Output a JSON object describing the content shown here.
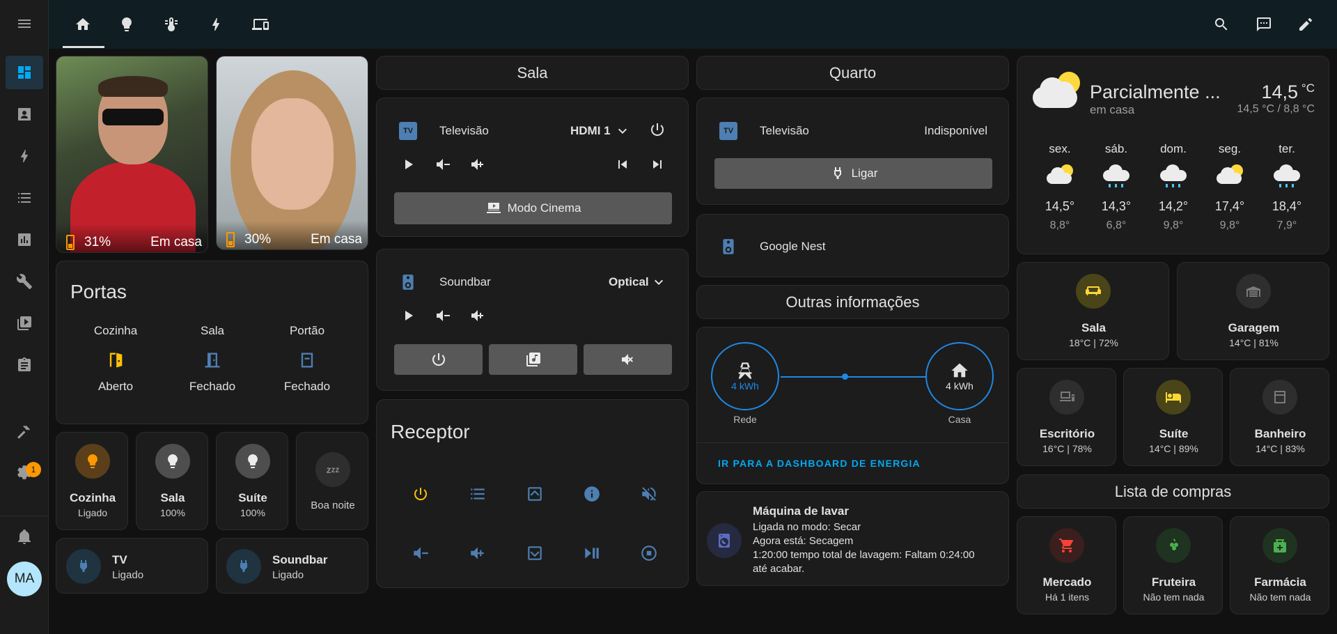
{
  "sidebar": {
    "avatar_initials": "MA",
    "settings_badge": "1",
    "items": [
      "menu-icon",
      "dashboard-icon",
      "account-box-icon",
      "lightning-icon",
      "list-icon",
      "chart-icon",
      "wrench-icon",
      "media-icon",
      "clipboard-icon",
      "hammer-icon",
      "gear-icon",
      "bell-icon"
    ]
  },
  "topbar": {
    "tabs": [
      "home-icon",
      "lightbulb-icon",
      "thermometer-icon",
      "lightning-icon",
      "devices-icon"
    ],
    "actions": [
      "search-icon",
      "chat-icon",
      "pencil-icon"
    ]
  },
  "persons": [
    {
      "battery": "31%",
      "status": "Em casa"
    },
    {
      "battery": "30%",
      "status": "Em casa"
    }
  ],
  "portas": {
    "title": "Portas",
    "doors": [
      {
        "name": "Cozinha",
        "state": "Aberto"
      },
      {
        "name": "Sala",
        "state": "Fechado"
      },
      {
        "name": "Portão",
        "state": "Fechado"
      }
    ]
  },
  "lights": [
    {
      "name": "Cozinha",
      "state": "Ligado"
    },
    {
      "name": "Sala",
      "state": "100%"
    },
    {
      "name": "Suíte",
      "state": "100%"
    },
    {
      "name": "Boa noite",
      "state": ""
    }
  ],
  "plugs": [
    {
      "name": "TV",
      "state": "Ligado"
    },
    {
      "name": "Soundbar",
      "state": "Ligado"
    }
  ],
  "sala": {
    "title": "Sala",
    "tv": {
      "name": "Televisão",
      "source": "HDMI 1",
      "cinema_label": "Modo Cinema"
    },
    "soundbar": {
      "name": "Soundbar",
      "source": "Optical"
    }
  },
  "receptor": {
    "title": "Receptor"
  },
  "quarto": {
    "title": "Quarto",
    "tv": {
      "name": "Televisão",
      "state": "Indisponível",
      "button": "Ligar"
    },
    "nest": {
      "name": "Google Nest"
    }
  },
  "outras": {
    "title": "Outras informações",
    "grid": {
      "value": "4 kWh",
      "label": "Rede"
    },
    "home": {
      "value": "4 kWh",
      "label": "Casa"
    },
    "link": "IR PARA A DASHBOARD DE ENERGIA"
  },
  "maquina": {
    "title": "Máquina de lavar",
    "lines": [
      "Ligada no modo: Secar",
      "Agora está: Secagem",
      "1:20:00 tempo total de lavagem: Faltam 0:24:00",
      "até acabar."
    ]
  },
  "weather": {
    "condition": "Parcialmente ...",
    "location": "em casa",
    "temp": "14,5",
    "unit": "°C",
    "range": "14,5 °C / 8,8 °C",
    "forecast": [
      {
        "day": "sex.",
        "icon": "partly-cloudy-icon",
        "high": "14,5°",
        "low": "8,8°"
      },
      {
        "day": "sáb.",
        "icon": "rainy-icon",
        "high": "14,3°",
        "low": "6,8°"
      },
      {
        "day": "dom.",
        "icon": "rainy-icon",
        "high": "14,2°",
        "low": "9,8°"
      },
      {
        "day": "seg.",
        "icon": "partly-cloudy-icon",
        "high": "17,4°",
        "low": "9,8°"
      },
      {
        "day": "ter.",
        "icon": "rainy-icon",
        "high": "18,4°",
        "low": "7,9°"
      }
    ]
  },
  "rooms": [
    {
      "name": "Sala",
      "state": "18°C | 72%"
    },
    {
      "name": "Garagem",
      "state": "14°C | 81%"
    },
    {
      "name": "Escritório",
      "state": "16°C | 78%"
    },
    {
      "name": "Suíte",
      "state": "14°C | 89%"
    },
    {
      "name": "Banheiro",
      "state": "14°C | 83%"
    }
  ],
  "compras": {
    "title": "Lista de compras",
    "lists": [
      {
        "name": "Mercado",
        "state": "Há 1 itens"
      },
      {
        "name": "Fruteira",
        "state": "Não tem nada"
      },
      {
        "name": "Farmácia",
        "state": "Não tem nada"
      }
    ]
  },
  "colors": {
    "accent": "#03a9f4",
    "active_yellow": "#ffc107",
    "topbar": "#101e24"
  }
}
